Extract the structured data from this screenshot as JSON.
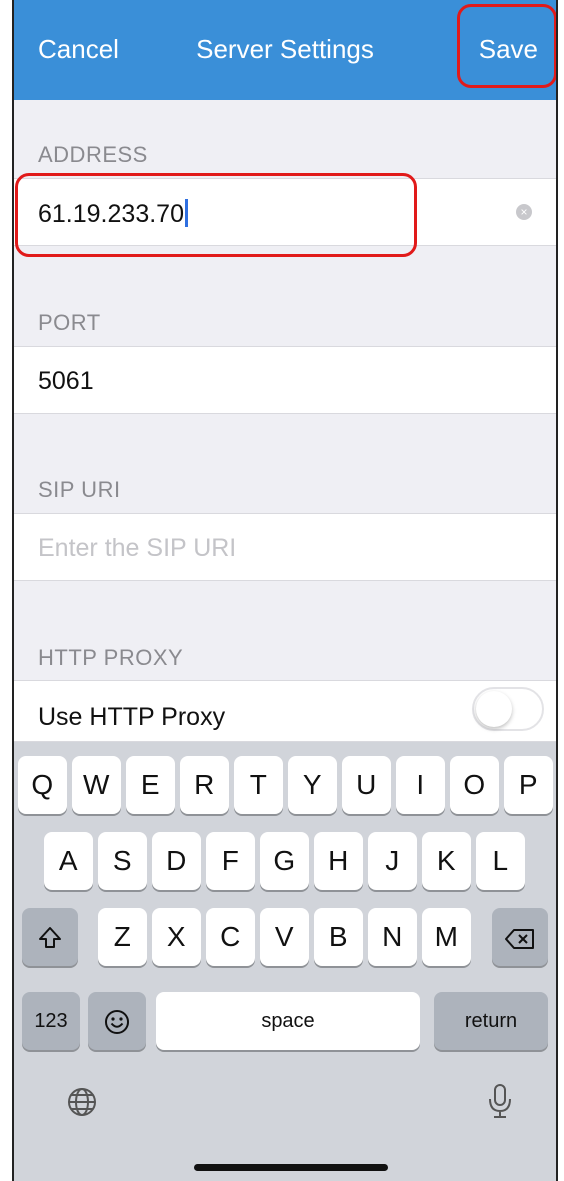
{
  "nav": {
    "cancel_label": "Cancel",
    "title": "Server Settings",
    "save_label": "Save"
  },
  "sections": {
    "address": {
      "header": "ADDRESS",
      "value": "61.19.233.70"
    },
    "port": {
      "header": "PORT",
      "value": "5061"
    },
    "sip_uri": {
      "header": "SIP URI",
      "placeholder": "Enter the SIP URI"
    },
    "http_proxy": {
      "header": "HTTP PROXY",
      "toggle_label": "Use HTTP Proxy",
      "toggle_on": false
    }
  },
  "keyboard": {
    "row1": [
      "Q",
      "W",
      "E",
      "R",
      "T",
      "Y",
      "U",
      "I",
      "O",
      "P"
    ],
    "row2": [
      "A",
      "S",
      "D",
      "F",
      "G",
      "H",
      "J",
      "K",
      "L"
    ],
    "row3": [
      "Z",
      "X",
      "C",
      "V",
      "B",
      "N",
      "M"
    ],
    "numbers_label": "123",
    "space_label": "space",
    "return_label": "return",
    "icons": {
      "shift": "shift-icon",
      "backspace": "backspace-icon",
      "emoji": "emoji-icon",
      "globe": "globe-icon",
      "mic": "microphone-icon"
    }
  },
  "colors": {
    "nav_bg": "#3a8fd8",
    "highlight": "#e11a1a",
    "keyboard_bg": "#d1d4da"
  }
}
